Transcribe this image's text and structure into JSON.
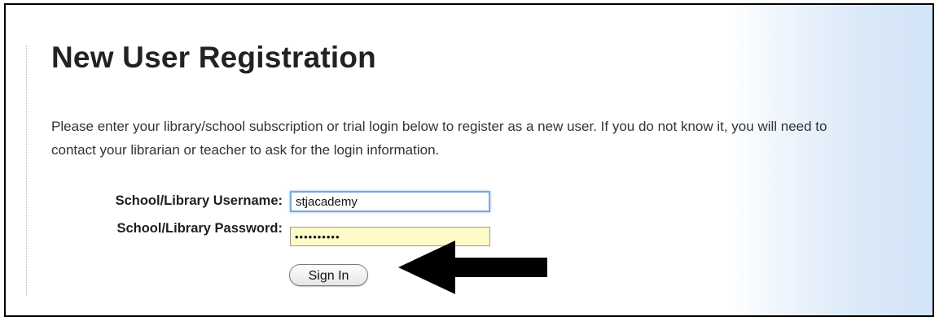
{
  "page": {
    "title": "New User Registration",
    "intro": "Please enter your library/school subscription or trial login below to register as a new user. If you do not know it, you will need to contact your librarian or teacher to ask for the login information."
  },
  "form": {
    "username_label": "School/Library Username:",
    "username_value": "stjacademy",
    "password_label": "School/Library Password:",
    "password_value": "••••••••••",
    "signin_label": "Sign In"
  },
  "annotation": {
    "icon": "left-arrow-icon",
    "color": "#000000"
  },
  "colors": {
    "password_bg": "#fdfbc7",
    "focus_border": "#7ca9dd",
    "side_gradient": "#d2e4f7"
  }
}
